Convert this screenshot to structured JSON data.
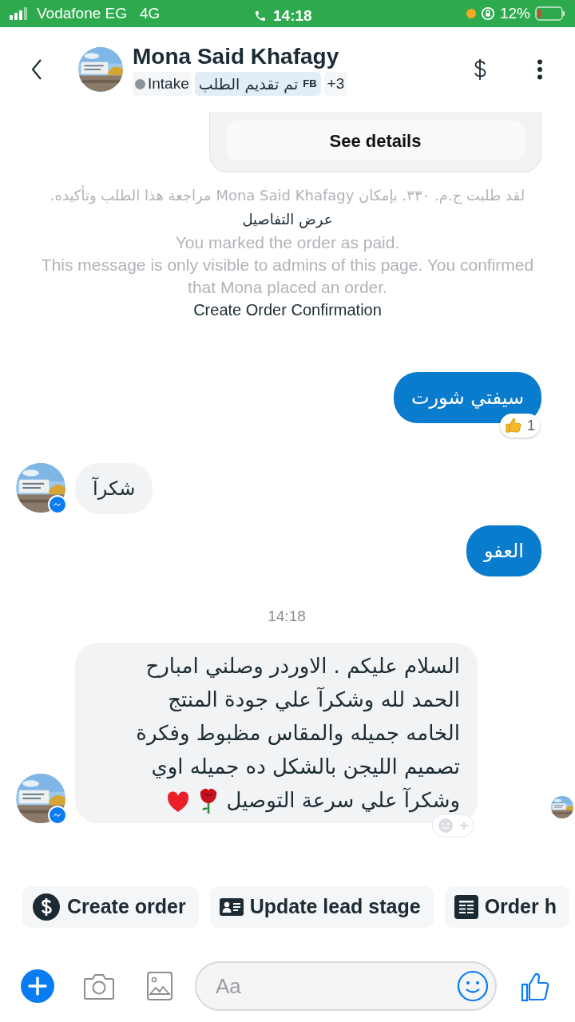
{
  "status_bar": {
    "carrier": "Vodafone EG",
    "network": "4G",
    "time": "14:18",
    "battery": "12%"
  },
  "header": {
    "name": "Mona Said Khafagy",
    "stage": "Intake",
    "label": "تم تقديم الطلب",
    "label_tag": "FB",
    "more_labels": "+3"
  },
  "order_card": {
    "button": "See details"
  },
  "system_messages": [
    {
      "kind": "rtl",
      "text": "لقد طلبت ج.م. ٣٣٠. بإمكان Mona Said Khafagy مراجعة هذا الطلب وتأكيده.",
      "link": "عرض التفاصيل"
    },
    {
      "kind": "note",
      "text": "You marked the order as paid."
    },
    {
      "kind": "note",
      "text": "This message is only visible to admins of this page. You confirmed that Mona placed an order."
    },
    {
      "kind": "link",
      "text": "Create Order Confirmation"
    }
  ],
  "messages": [
    {
      "kind": "sent",
      "text": "سيفتي شورت",
      "reaction_count": "1"
    },
    {
      "kind": "received",
      "text": "شكرآ"
    },
    {
      "kind": "sent",
      "text": "العفو"
    },
    {
      "kind": "time",
      "text": "14:18"
    },
    {
      "kind": "received",
      "text": "السلام عليكم . الاوردر وصلني امبارح الحمد لله وشكرآ علي جودة المنتج الخامه جميله والمقاس مظبوط وفكرة تصميم الليجن بالشكل ده جميله اوي وشكرآ علي سرعة التوصيل",
      "seen": true
    }
  ],
  "quick_replies": {
    "create_order": {
      "label": "Create order"
    },
    "update_lead_stage": {
      "label": "Update lead stage"
    },
    "action_3": {
      "label": "Order h"
    }
  },
  "composer": {
    "placeholder": "Aa"
  }
}
